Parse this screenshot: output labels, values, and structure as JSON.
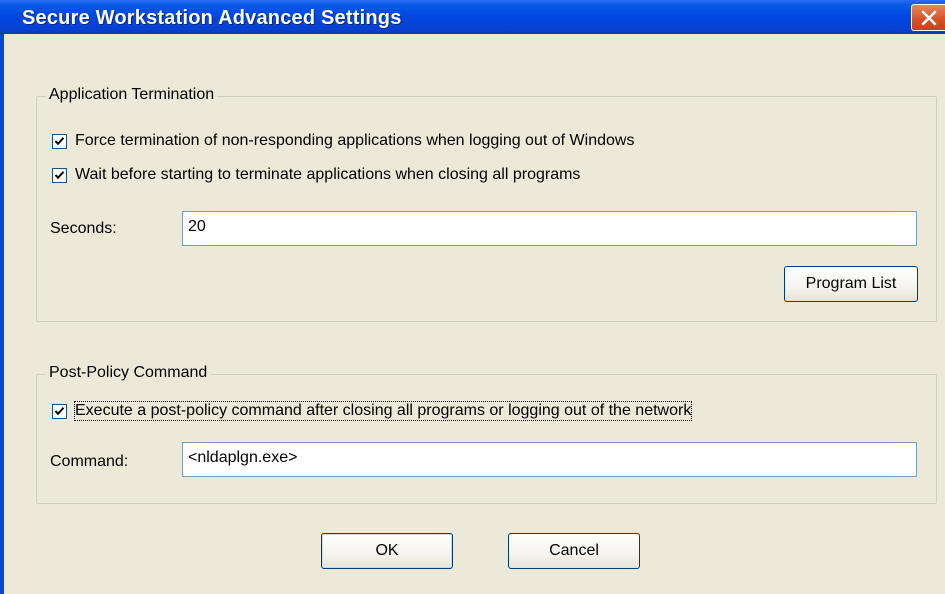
{
  "window": {
    "title": "Secure Workstation Advanced Settings"
  },
  "app_termination": {
    "legend": "Application Termination",
    "force_termination": {
      "label": "Force termination of non-responding applications when logging out of Windows",
      "checked": true
    },
    "wait_before": {
      "label": "Wait before starting to terminate applications when closing all programs",
      "checked": true
    },
    "seconds_label": "Seconds:",
    "seconds_value": "20",
    "program_list_button": "Program List"
  },
  "post_policy": {
    "legend": "Post-Policy Command",
    "execute": {
      "label": "Execute a post-policy command after closing all programs or logging out of the network",
      "checked": true
    },
    "command_label": "Command:",
    "command_value": "<nldaplgn.exe>"
  },
  "buttons": {
    "ok": "OK",
    "cancel": "Cancel"
  },
  "colors": {
    "titlebar": "#0046df",
    "dialog_bg": "#ece9d8",
    "close_button": "#d8532c",
    "checkbox_border": "#1c5180"
  }
}
